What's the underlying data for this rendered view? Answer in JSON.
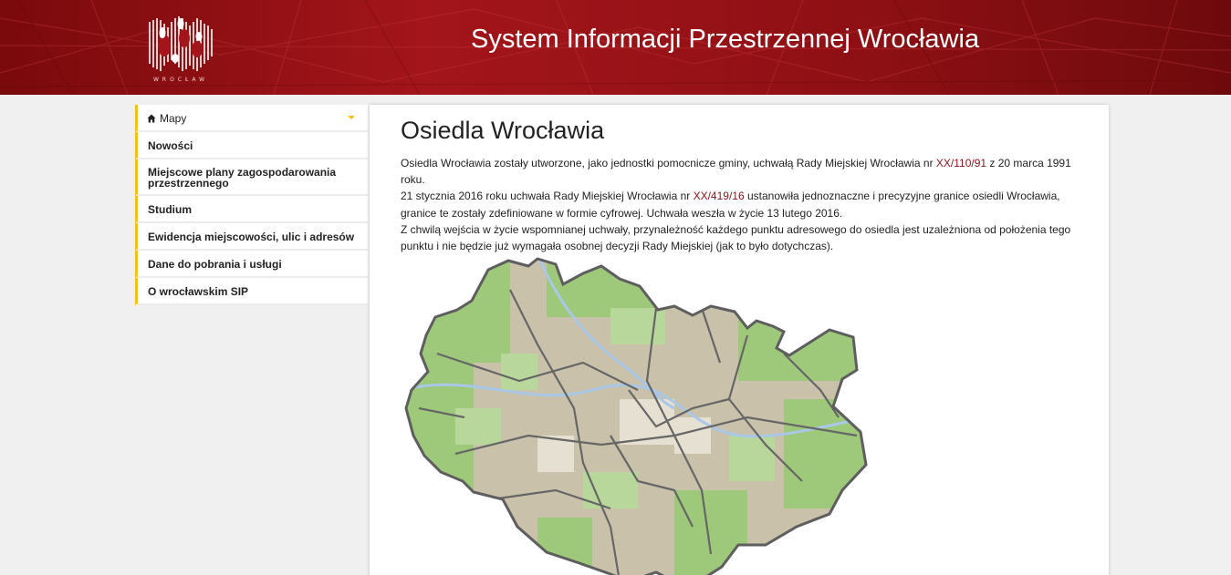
{
  "header": {
    "logo_caption": "WROCŁAW",
    "title": "System Informacji Przestrzennej Wrocławia"
  },
  "sidebar": {
    "items": [
      {
        "label": "Mapy",
        "icon": "home-icon"
      },
      {
        "label": "Nowości"
      },
      {
        "label": "Miejscowe plany zagospodarowania przestrzennego"
      },
      {
        "label": "Studium"
      },
      {
        "label": "Ewidencja miejscowości, ulic i adresów"
      },
      {
        "label": "Dane do pobrania i usługi"
      },
      {
        "label": "O wrocławskim SIP"
      }
    ]
  },
  "main": {
    "title": "Osiedla Wrocławia",
    "p1_a": "Osiedla Wrocławia zostały utworzone, jako jednostki pomocnicze gminy, uchwałą Rady Miejskiej Wrocławia nr ",
    "p1_link": "XX/110/91",
    "p1_b": " z 20 marca 1991 roku.",
    "p2_a": "21 stycznia 2016 roku uchwała Rady Miejskiej Wrocławia nr ",
    "p2_link": "XX/419/16",
    "p2_b": " ustanowiła jednoznaczne i precyzyjne granice osiedli Wrocławia, granice te zostały zdefiniowane w formie cyfrowej. Uchwała weszła w życie 13 lutego 2016.",
    "p3": "Z chwilą wejścia w życie wspomnianej uchwały, przynależność każdego punktu adresowego do osiedla jest uzależniona od położenia tego punktu i nie będzie już wymagała osobnej decyzji Rady Miejskiej (jak to było dotychczas)."
  },
  "colors": {
    "header_red": "#a3151a",
    "accent_yellow": "#f2c21a",
    "link": "#8a1316",
    "map_green": "#9ec97a",
    "map_built": "#cfc6b0",
    "map_boundary": "#666666",
    "map_water": "#a9c8e8"
  }
}
